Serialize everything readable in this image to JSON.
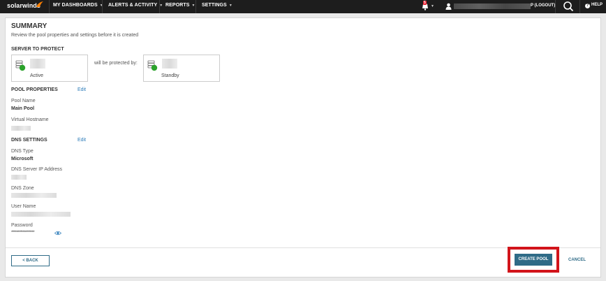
{
  "nav": {
    "brand": "solarwinds",
    "menu": [
      {
        "label": "MY DASHBOARDS"
      },
      {
        "label": "ALERTS & ACTIVITY"
      },
      {
        "label": "REPORTS"
      },
      {
        "label": "SETTINGS"
      }
    ],
    "notification_count": "5",
    "logout": "P (LOGOUT)",
    "help": "HELP",
    "accent": "#ff7f00"
  },
  "summary": {
    "title": "SUMMARY",
    "subtitle": "Review the pool properties and settings before it is created"
  },
  "server": {
    "section": "SERVER TO PROTECT",
    "active_label": "Active",
    "protected_text": "will be protected by:",
    "standby_label": "Standby",
    "status_color": "#2aa22a"
  },
  "pool": {
    "section": "POOL PROPERTIES",
    "edit": "Edit",
    "name_label": "Pool Name",
    "name_value": "Main Pool",
    "hostname_label": "Virtual Hostname"
  },
  "dns": {
    "section": "DNS SETTINGS",
    "edit": "Edit",
    "type_label": "DNS Type",
    "type_value": "Microsoft",
    "server_ip_label": "DNS Server IP Address",
    "zone_label": "DNS Zone",
    "user_label": "User Name",
    "password_label": "Password",
    "password_value": "******************"
  },
  "footer": {
    "back": "< BACK",
    "create": "CREATE POOL",
    "cancel": "CANCEL",
    "primary_color": "#2f6b87",
    "highlight_color": "#d2141b"
  }
}
